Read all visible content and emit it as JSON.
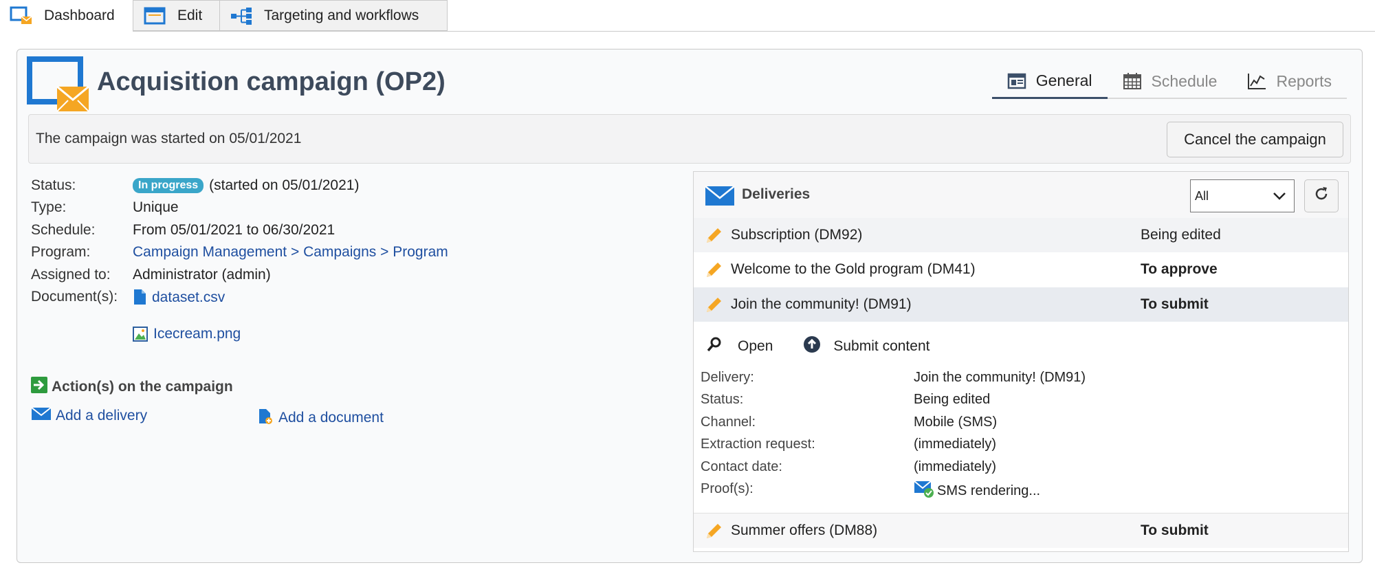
{
  "tabs": [
    {
      "label": "Dashboard",
      "icon": "dashboard-icon"
    },
    {
      "label": "Edit",
      "icon": "edit-window-icon"
    },
    {
      "label": "Targeting and workflows",
      "icon": "workflow-icon"
    }
  ],
  "header": {
    "title": "Acquisition campaign (OP2)",
    "view_tabs": [
      {
        "label": "General",
        "icon": "general-icon"
      },
      {
        "label": "Schedule",
        "icon": "calendar-icon"
      },
      {
        "label": "Reports",
        "icon": "reports-icon"
      }
    ]
  },
  "infobar": {
    "message": "The campaign was started on 05/01/2021",
    "cancel_label": "Cancel the campaign"
  },
  "properties": {
    "status_label": "Status:",
    "status_badge": "In progress",
    "status_text": "(started on 05/01/2021)",
    "type_label": "Type:",
    "type_value": "Unique",
    "schedule_label": "Schedule:",
    "schedule_value": "From 05/01/2021 to 06/30/2021",
    "program_label": "Program:",
    "program_value": "Campaign Management > Campaigns > Program",
    "assigned_label": "Assigned to:",
    "assigned_value": "Administrator (admin)",
    "documents_label": "Document(s):",
    "documents": [
      "dataset.csv",
      "Icecream.png"
    ]
  },
  "actions": {
    "title": "Action(s) on the campaign",
    "add_delivery": "Add a delivery",
    "add_document": "Add a document"
  },
  "deliveries": {
    "title": "Deliveries",
    "filter_value": "All",
    "rows": [
      {
        "name": "Subscription (DM92)",
        "status": "Being edited"
      },
      {
        "name": "Welcome to the Gold program (DM41)",
        "status": "To approve"
      },
      {
        "name": "Join the community! (DM91)",
        "status": "To submit"
      },
      {
        "name": "Summer offers (DM88)",
        "status": "To submit"
      }
    ],
    "detail": {
      "open_label": "Open",
      "submit_label": "Submit content",
      "fields": [
        {
          "label": "Delivery:",
          "value": "Join the community! (DM91)"
        },
        {
          "label": "Status:",
          "value": "Being edited"
        },
        {
          "label": "Channel:",
          "value": "Mobile (SMS)"
        },
        {
          "label": "Extraction request:",
          "value": "(immediately)"
        },
        {
          "label": "Contact date:",
          "value": "(immediately)"
        },
        {
          "label": "Proof(s):",
          "value": "SMS rendering..."
        }
      ]
    }
  },
  "colors": {
    "accent_blue": "#1f78d1",
    "envelope_orange": "#f5a623",
    "badge": "#3aa6c9",
    "title_text": "#3d4a5c",
    "link": "#1f4fa0",
    "highlight_row": "#e8ebf0"
  }
}
